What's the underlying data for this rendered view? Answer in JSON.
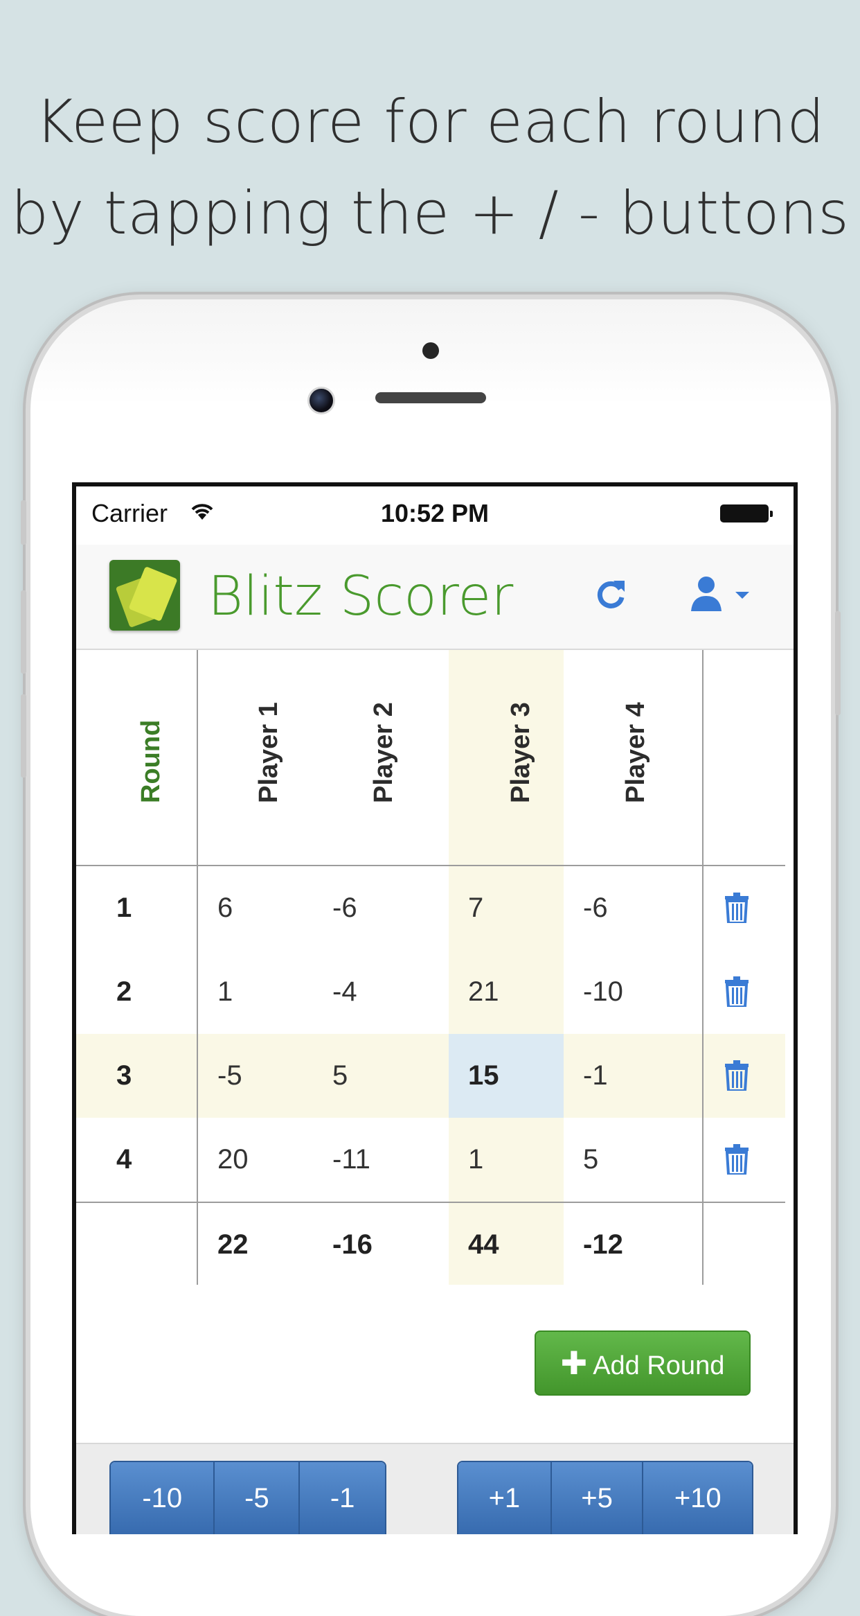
{
  "caption": {
    "line1": "Keep score for each round",
    "line2": "by tapping the + / - buttons"
  },
  "status_bar": {
    "carrier": "Carrier",
    "time": "10:52 PM"
  },
  "navbar": {
    "brand": "Blitz Scorer",
    "refresh_icon": "refresh-icon",
    "user_icon": "user-menu-icon"
  },
  "table": {
    "headers": [
      "Round",
      "Player 1",
      "Player 2",
      "Player 3",
      "Player 4"
    ],
    "rows": [
      {
        "round": "1",
        "scores": [
          "6",
          "-6",
          "7",
          "-6"
        ]
      },
      {
        "round": "2",
        "scores": [
          "1",
          "-4",
          "21",
          "-10"
        ]
      },
      {
        "round": "3",
        "scores": [
          "-5",
          "5",
          "15",
          "-1"
        ]
      },
      {
        "round": "4",
        "scores": [
          "20",
          "-11",
          "1",
          "5"
        ]
      }
    ],
    "totals": [
      "22",
      "-16",
      "44",
      "-12"
    ],
    "selected_round": 3,
    "selected_player": 3
  },
  "add_round_label": "Add Round",
  "decrement_buttons": [
    "-10",
    "-5",
    "-1"
  ],
  "increment_buttons": [
    "+1",
    "+5",
    "+10"
  ],
  "colors": {
    "brand_green": "#4a9a2e",
    "link_blue": "#3a7bd5",
    "highlight": "#faf8e6",
    "active_cell": "#dceaf3"
  }
}
